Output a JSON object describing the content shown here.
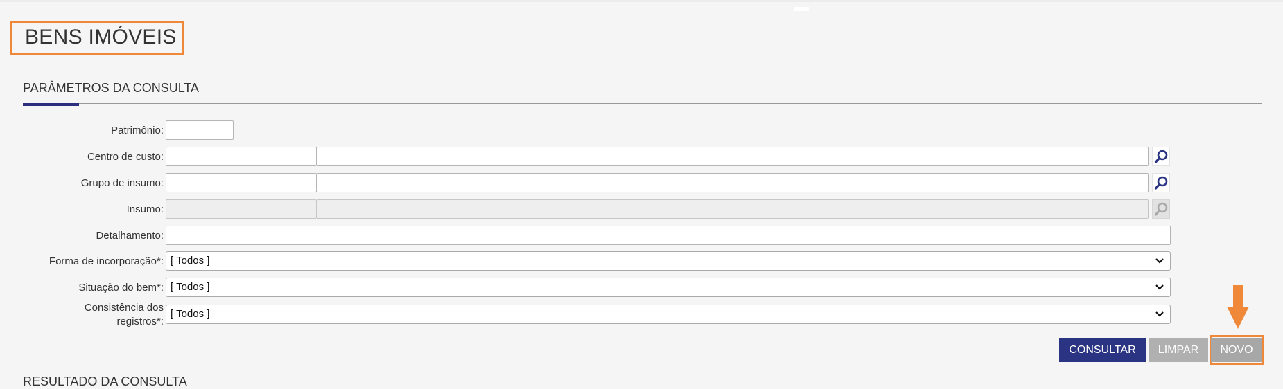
{
  "page": {
    "title": "BENS IMÓVEIS"
  },
  "colors": {
    "highlight": "#f0883a",
    "primary": "#2b3383",
    "accent_line": "#2b2f7e",
    "secondary_button": "#b0b0b0"
  },
  "query_params": {
    "section_title": "PARÂMETROS DA CONSULTA",
    "fields": {
      "patrimonio": {
        "label": "Patrimônio:",
        "value": ""
      },
      "centro_custo": {
        "label": "Centro de custo:",
        "code": "",
        "description": ""
      },
      "grupo_insumo": {
        "label": "Grupo de insumo:",
        "code": "",
        "description": ""
      },
      "insumo": {
        "label": "Insumo:",
        "code": "",
        "description": "",
        "disabled": true
      },
      "detalhamento": {
        "label": "Detalhamento:",
        "value": ""
      },
      "forma_incorporacao": {
        "label": "Forma de incorporação*:",
        "selected": "[ Todos ]"
      },
      "situacao_bem": {
        "label": "Situação do bem*:",
        "selected": "[ Todos ]"
      },
      "consistencia_registros": {
        "label_line1": "Consistência dos",
        "label_line2": "registros*:",
        "selected": "[ Todos ]"
      }
    }
  },
  "buttons": {
    "consultar": "CONSULTAR",
    "limpar": "LIMPAR",
    "novo": "NOVO"
  },
  "icons": {
    "lookup": "magnifier-icon",
    "dropdown": "chevron-down-icon",
    "callout": "arrow-down-icon"
  },
  "results": {
    "section_title": "RESULTADO DA CONSULTA"
  }
}
